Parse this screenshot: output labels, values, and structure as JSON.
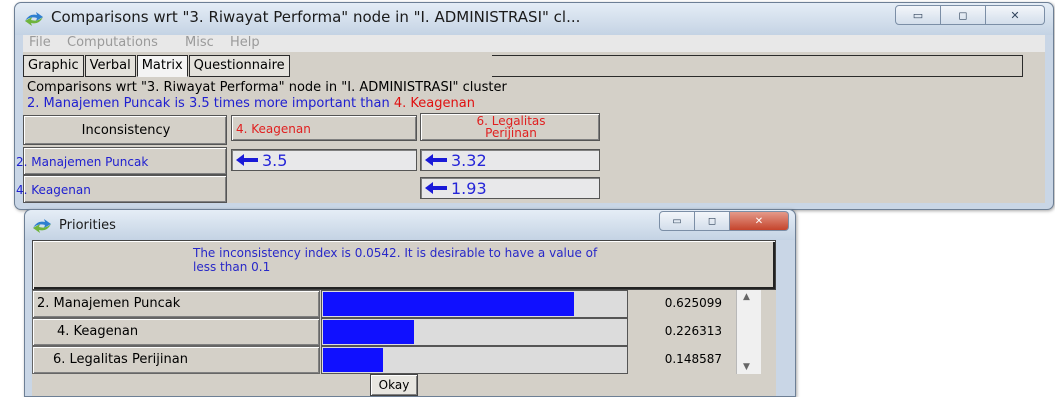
{
  "comparison_window": {
    "title": "Comparisons wrt \"3. Riwayat Performa\" node in \"I. ADMINISTRASI\" cl...",
    "menu": [
      "File",
      "Computations",
      "Misc",
      "Help"
    ],
    "tabs": [
      "Graphic",
      "Verbal",
      "Matrix",
      "Questionnaire"
    ],
    "active_tab": "Matrix",
    "description_line1": "Comparisons wrt \"3. Riwayat Performa\" node in \"I. ADMINISTRASI\" cluster",
    "description_line2": {
      "part1": "2. Manajemen Puncak",
      "part2": " is 3.5 times more important than ",
      "part3": "4. Keagenan"
    },
    "matrix": {
      "corner_button": "Inconsistency",
      "col_headers": [
        "4. Keagenan",
        "6. Legalitas Perijinan"
      ],
      "row_headers": [
        "2. Manajemen Puncak",
        "4. Keagenan"
      ],
      "cells": {
        "r1c1": "3.5",
        "r1c2": "3.32",
        "r2c2": "1.93"
      }
    }
  },
  "priorities_window": {
    "title": "Priorities",
    "inconsistency_message": "The inconsistency index is 0.0542.  It is desirable to have a value of less than 0.1",
    "rows": [
      {
        "label": "2. Manajemen Puncak",
        "value": "0.625099",
        "fraction": 0.625099
      },
      {
        "label": "4. Keagenan",
        "value": "0.226313",
        "fraction": 0.226313
      },
      {
        "label": "6. Legalitas Perijinan",
        "value": "0.148587",
        "fraction": 0.148587
      }
    ],
    "ok_label": "Okay"
  },
  "colors": {
    "bar": "#1010ff",
    "blue_text": "#2020d0",
    "red_text": "#e01010"
  }
}
